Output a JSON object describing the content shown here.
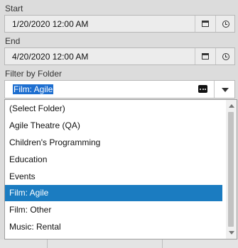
{
  "start": {
    "label": "Start",
    "value": "1/20/2020 12:00 AM",
    "date_icon": "calendar-icon",
    "time_icon": "clock-icon"
  },
  "end": {
    "label": "End",
    "value": "4/20/2020 12:00 AM",
    "date_icon": "calendar-icon",
    "time_icon": "clock-icon"
  },
  "folder": {
    "label": "Filter by Folder",
    "selected": "Film: Agile",
    "options": [
      "(Select Folder)",
      "Agile Theatre (QA)",
      "Children's Programming",
      "Education",
      "Events",
      "Film: Agile",
      "Film: Other",
      "Music: Rental"
    ],
    "selected_index": 5
  },
  "colors": {
    "selection": "#1b7cc1",
    "text_highlight": "#1e6fd0",
    "background": "#dcdcdc"
  }
}
